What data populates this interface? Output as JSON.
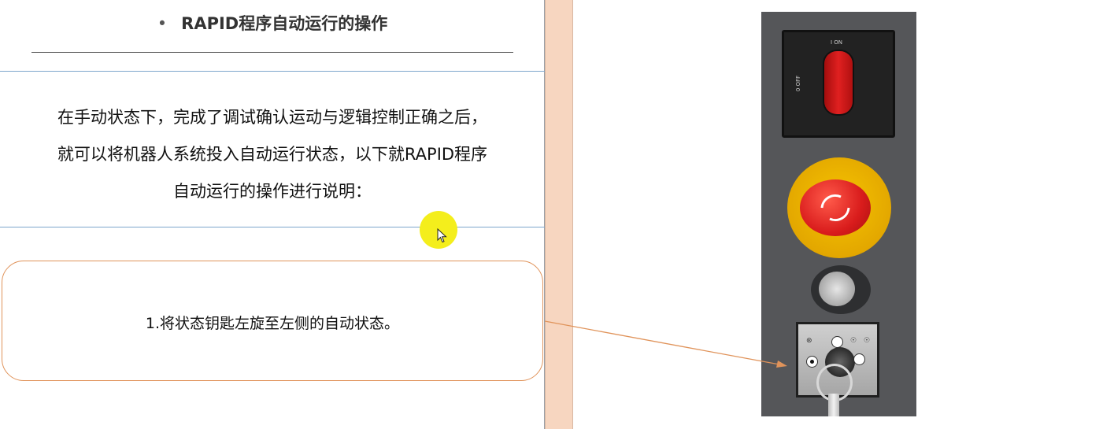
{
  "slide": {
    "title_bullet": "•",
    "title": "RAPID程序自动运行的操作",
    "intro_lines": [
      "在手动状态下，完成了调试确认运动与逻辑控制正确之后，",
      "就可以将机器人系统投入自动运行状态，以下就RAPID程序",
      "自动运行的操作进行说明："
    ],
    "step_text": "1.将状态钥匙左旋至左侧的自动状态。"
  },
  "panel": {
    "switch_on_label": "I ON",
    "switch_off_label": "0 OFF"
  },
  "colors": {
    "divider_strip": "#f7d6c0",
    "callout_border": "#e0935a",
    "callout_arrow": "#e0935a",
    "blue_rule": "#7ea6cc",
    "cursor_highlight": "#f4ee1c",
    "panel_background": "#555659",
    "estop_red": "#d91c1c",
    "estop_yellow": "#f6c400"
  },
  "icons": {
    "cursor": "mouse-pointer-icon",
    "estop": "emergency-stop-icon",
    "key": "key-icon"
  }
}
